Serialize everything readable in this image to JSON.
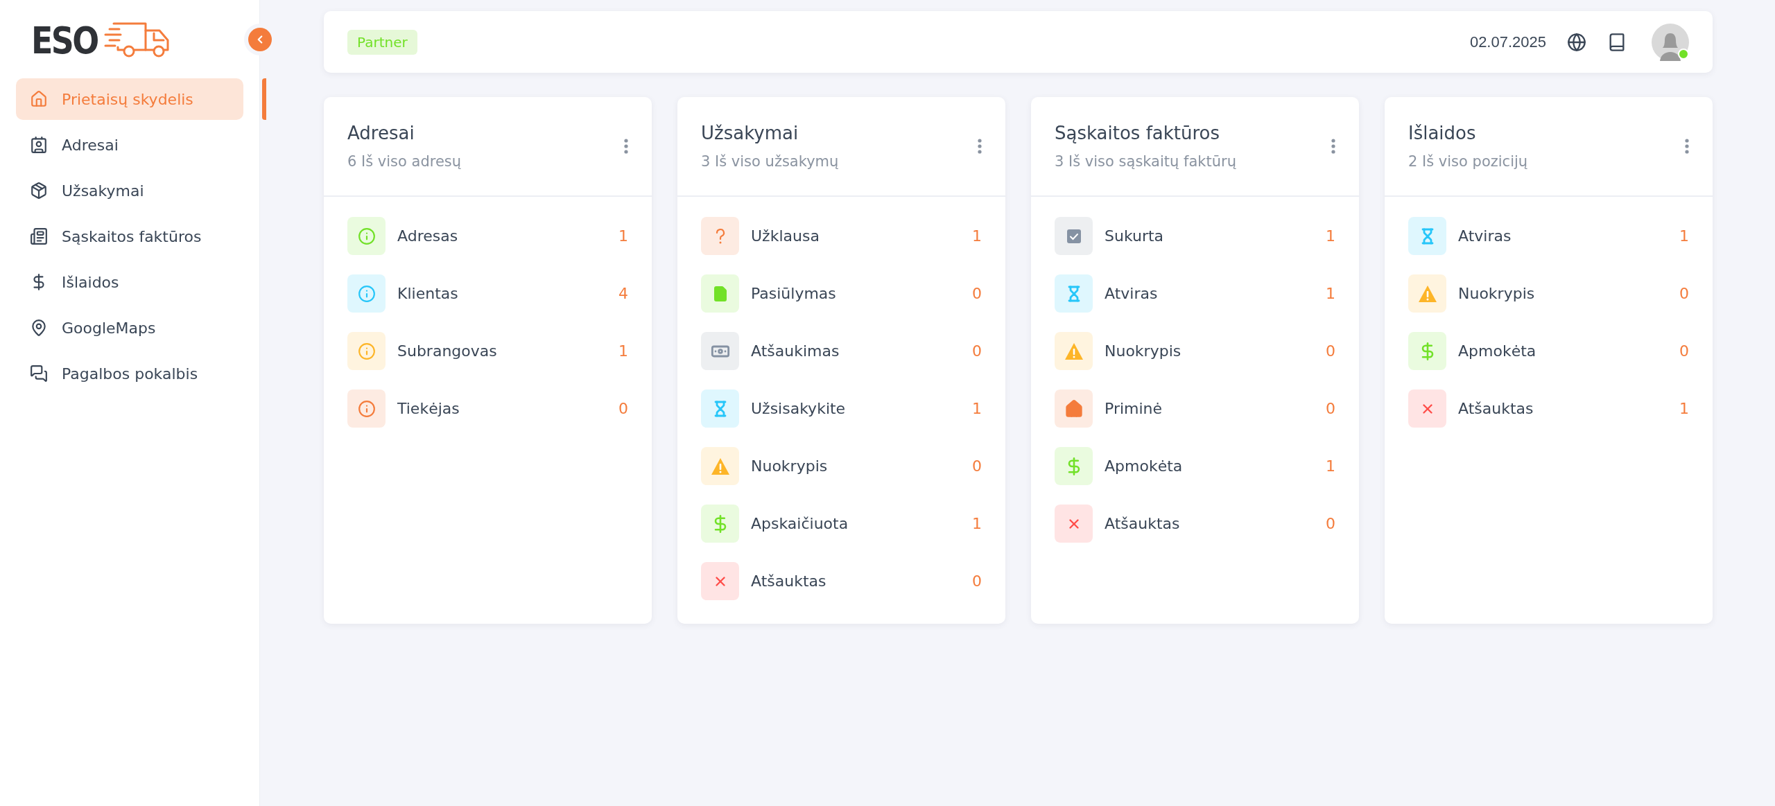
{
  "logo": {
    "text": "ESO"
  },
  "sidebar": {
    "items": [
      {
        "label": "Prietaisų skydelis",
        "kind": "home",
        "selected": true
      },
      {
        "label": "Adresai",
        "kind": "contacts",
        "selected": false
      },
      {
        "label": "Užsakymai",
        "kind": "box",
        "selected": false
      },
      {
        "label": "Sąskaitos faktūros",
        "kind": "invoice",
        "selected": false
      },
      {
        "label": "Išlaidos",
        "kind": "dollar",
        "selected": false
      },
      {
        "label": "GoogleMaps",
        "kind": "pin",
        "selected": false
      },
      {
        "label": "Pagalbos pokalbis",
        "kind": "chat",
        "selected": false
      }
    ]
  },
  "header": {
    "badge": "Partner",
    "date": "02.07.2025",
    "avatar": {
      "online": true
    }
  },
  "cards": [
    {
      "title": "Adresai",
      "subtitle": "6 Iš viso adresų",
      "rows": [
        {
          "label": "Adresas",
          "count": "1",
          "kind": "info",
          "color": "#72e128"
        },
        {
          "label": "Klientas",
          "count": "4",
          "kind": "info",
          "color": "#26c6f9"
        },
        {
          "label": "Subrangovas",
          "count": "1",
          "kind": "info",
          "color": "#fdb528"
        },
        {
          "label": "Tiekėjas",
          "count": "0",
          "kind": "info",
          "color": "#f47c3c"
        }
      ]
    },
    {
      "title": "Užsakymai",
      "subtitle": "3 Iš viso užsakymų",
      "rows": [
        {
          "label": "Užklausa",
          "count": "1",
          "kind": "question",
          "color": "#f47c3c"
        },
        {
          "label": "Pasiūlymas",
          "count": "0",
          "kind": "file",
          "color": "#72e128"
        },
        {
          "label": "Atšaukimas",
          "count": "0",
          "kind": "money",
          "color": "#8592a3"
        },
        {
          "label": "Užsisakykite",
          "count": "1",
          "kind": "hourglass",
          "color": "#26c6f9"
        },
        {
          "label": "Nuokrypis",
          "count": "0",
          "kind": "warning",
          "color": "#fdb528"
        },
        {
          "label": "Apskaičiuota",
          "count": "1",
          "kind": "dollar",
          "color": "#72e128"
        },
        {
          "label": "Atšauktas",
          "count": "0",
          "kind": "cross",
          "color": "#ff4d49"
        }
      ]
    },
    {
      "title": "Sąskaitos faktūros",
      "subtitle": "3 Iš viso sąskaitų faktūrų",
      "rows": [
        {
          "label": "Sukurta",
          "count": "1",
          "kind": "check",
          "color": "#8592a3"
        },
        {
          "label": "Atviras",
          "count": "1",
          "kind": "hourglass",
          "color": "#26c6f9"
        },
        {
          "label": "Nuokrypis",
          "count": "0",
          "kind": "warning",
          "color": "#fdb528"
        },
        {
          "label": "Priminė",
          "count": "0",
          "kind": "home",
          "color": "#f47c3c"
        },
        {
          "label": "Apmokėta",
          "count": "1",
          "kind": "dollar",
          "color": "#72e128"
        },
        {
          "label": "Atšauktas",
          "count": "0",
          "kind": "cross",
          "color": "#ff4d49"
        }
      ]
    },
    {
      "title": "Išlaidos",
      "subtitle": "2 Iš viso pozicijų",
      "rows": [
        {
          "label": "Atviras",
          "count": "1",
          "kind": "hourglass",
          "color": "#26c6f9"
        },
        {
          "label": "Nuokrypis",
          "count": "0",
          "kind": "warning",
          "color": "#fdb528"
        },
        {
          "label": "Apmokėta",
          "count": "0",
          "kind": "dollar",
          "color": "#72e128"
        },
        {
          "label": "Atšauktas",
          "count": "1",
          "kind": "cross",
          "color": "#ff4d49"
        }
      ]
    }
  ]
}
